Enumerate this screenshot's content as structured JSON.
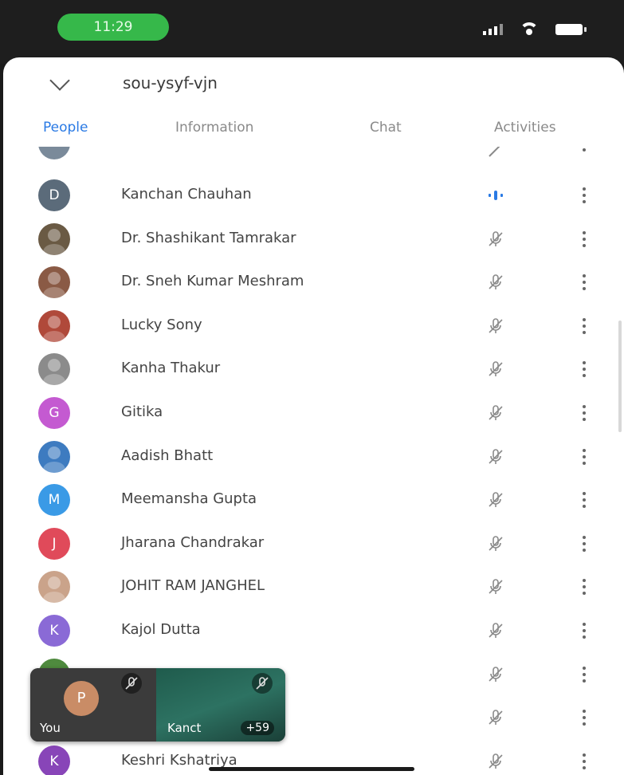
{
  "status_bar": {
    "time": "11:29"
  },
  "header": {
    "meeting_code": "sou-ysyf-vjn"
  },
  "tabs": [
    {
      "label": "People",
      "active": true
    },
    {
      "label": "Information",
      "active": false
    },
    {
      "label": "Chat",
      "active": false
    },
    {
      "label": "Activities",
      "active": false
    }
  ],
  "participants": [
    {
      "name": "Kanchan Chauhan",
      "initial": "D",
      "avatar_color": "#5b6b7a",
      "photo": false,
      "speaking": true
    },
    {
      "name": "Dr. Shashikant Tamrakar",
      "initial": "",
      "avatar_color": "#6a5a44",
      "photo": true,
      "speaking": false
    },
    {
      "name": "Dr. Sneh Kumar Meshram",
      "initial": "",
      "avatar_color": "#8a5a45",
      "photo": true,
      "speaking": false
    },
    {
      "name": "Lucky Sony",
      "initial": "",
      "avatar_color": "#b0493a",
      "photo": true,
      "speaking": false
    },
    {
      "name": "Kanha Thakur",
      "initial": "",
      "avatar_color": "#8b8b8b",
      "photo": true,
      "speaking": false
    },
    {
      "name": "Gitika",
      "initial": "G",
      "avatar_color": "#c45ad1",
      "photo": false,
      "speaking": false
    },
    {
      "name": "Aadish Bhatt",
      "initial": "",
      "avatar_color": "#3d7bc0",
      "photo": true,
      "speaking": false
    },
    {
      "name": "Meemansha Gupta",
      "initial": "M",
      "avatar_color": "#3a9ae6",
      "photo": false,
      "speaking": false
    },
    {
      "name": "Jharana Chandrakar",
      "initial": "J",
      "avatar_color": "#e04a5a",
      "photo": false,
      "speaking": false
    },
    {
      "name": "JOHIT RAM JANGHEL",
      "initial": "",
      "avatar_color": "#caa38a",
      "photo": true,
      "speaking": false
    },
    {
      "name": "Kajol Dutta",
      "initial": "K",
      "avatar_color": "#8a6ad6",
      "photo": false,
      "speaking": false
    },
    {
      "name": "",
      "initial": "",
      "avatar_color": "#4f8a3e",
      "photo": false,
      "speaking": false
    },
    {
      "name": "",
      "initial": "",
      "avatar_color": "#ffffff",
      "photo": false,
      "speaking": false
    },
    {
      "name": "Keshri Kshatriya",
      "initial": "K",
      "avatar_color": "#8845b8",
      "photo": false,
      "speaking": false
    }
  ],
  "pip": {
    "self_initial": "P",
    "self_label": "You",
    "other_label": "Kanct",
    "other_count": "+59"
  },
  "colors": {
    "accent": "#2a7ae4",
    "speaking": "#2a7ae4",
    "muted_icon": "#8a8a8a"
  }
}
